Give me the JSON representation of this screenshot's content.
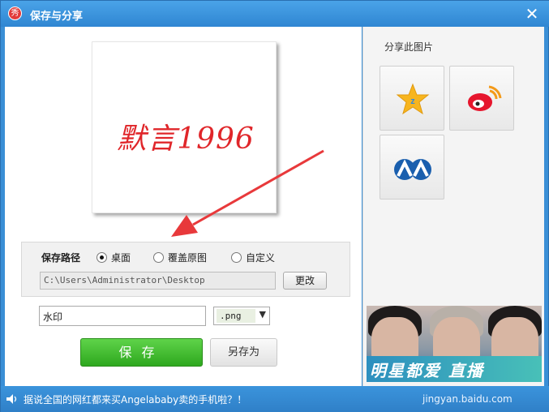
{
  "window": {
    "title": "保存与分享",
    "app_icon_glyph": "秀",
    "close_glyph": "✕"
  },
  "preview": {
    "text": "默言1996",
    "text_color": "#e0262a"
  },
  "save_path": {
    "label": "保存路径",
    "options": [
      {
        "label": "桌面",
        "checked": true
      },
      {
        "label": "覆盖原图",
        "checked": false
      },
      {
        "label": "自定义",
        "checked": false
      }
    ],
    "path_value": "C:\\Users\\Administrator\\Desktop",
    "change_label": "更改"
  },
  "watermark": {
    "value": "水印"
  },
  "format": {
    "selected": ".png"
  },
  "actions": {
    "save_label": "保存",
    "save_as_label": "另存为",
    "save_color": "#3cbf2a"
  },
  "share": {
    "title": "分享此图片",
    "targets": [
      {
        "icon": "qzone-star-icon"
      },
      {
        "icon": "weibo-icon"
      },
      {
        "icon": "renren-icon"
      }
    ]
  },
  "banner": {
    "text": "明星都爱 直播"
  },
  "status": {
    "text": "据说全国的网红都来买Angelababy卖的手机啦？！",
    "site": "jingyan.baidu.com"
  },
  "colors": {
    "titlebar": "#2f86d2",
    "accent_green": "#3cbf2a",
    "arrow_red": "#e8393b"
  }
}
